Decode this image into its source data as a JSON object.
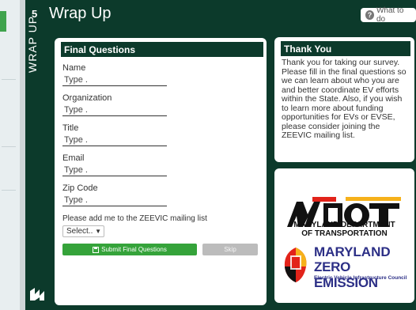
{
  "step_number": "5",
  "page_title": "Wrap Up",
  "vertical_title": "WRAP UP",
  "what_to_do": "What to do",
  "form": {
    "header": "Final Questions",
    "fields": [
      {
        "label": "Name",
        "placeholder": "Type ."
      },
      {
        "label": "Organization",
        "placeholder": "Type ."
      },
      {
        "label": "Title",
        "placeholder": "Type ."
      },
      {
        "label": "Email",
        "placeholder": "Type ."
      },
      {
        "label": "Zip Code",
        "placeholder": "Type ."
      }
    ],
    "mailing_label": "Please add me to the ZEEVIC mailing list",
    "select_value": "Select..",
    "submit_label": "Submit Final Questions",
    "skip_label": "Skip"
  },
  "thank_you": {
    "header": "Thank You",
    "text": "Thank you for taking our survey. Please fill in the final questions so we can learn about who you are and better coordinate EV efforts within the State. Also, if you wish to learn more about funding opportunities for EVs or EVSE, please consider joining the ZEEVIC mailing list."
  },
  "logos": {
    "mdot_line1": "MARYLAND DEPARTMENT",
    "mdot_line2": "OF TRANSPORTATION",
    "mze_line1": "MARYLAND",
    "mze_line2": "ZERO EMISSION",
    "mze_line3": "Electric Vehicle Infrastructure Council"
  },
  "colors": {
    "panel": "#0c3a2b",
    "submit": "#35a33a",
    "skip": "#bcbcbc"
  }
}
